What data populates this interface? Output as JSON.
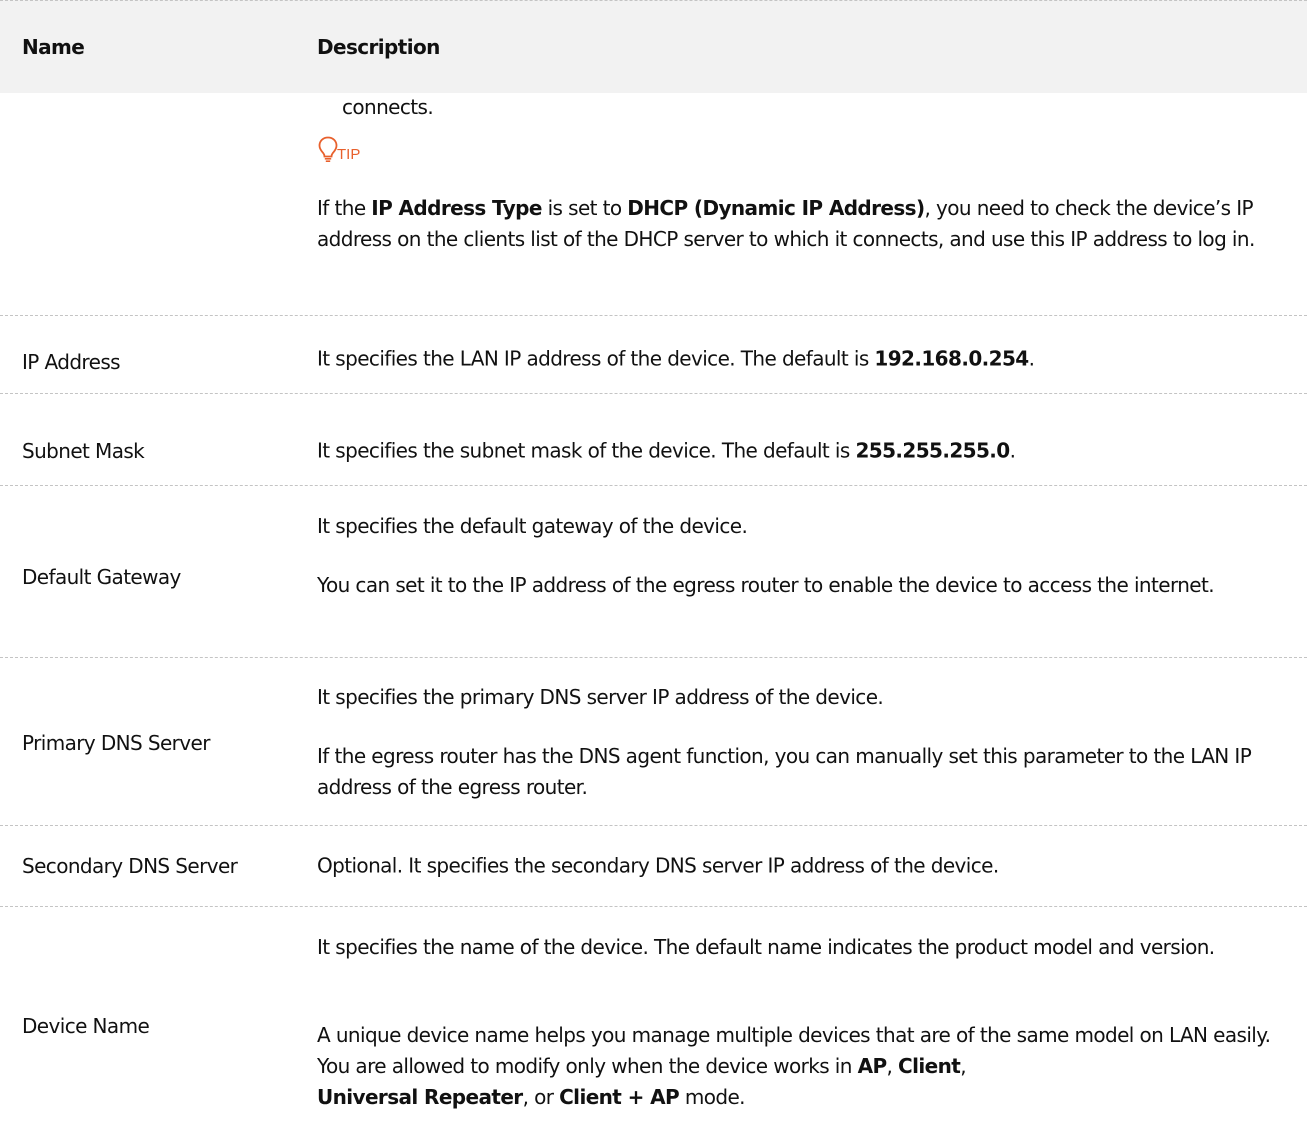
{
  "header": {
    "name": "Name",
    "description": "Description"
  },
  "continuation": {
    "text": "connects.",
    "tip_label": "TIP",
    "tip": {
      "t1": "If the ",
      "b1": "IP Address Type",
      "t2": " is set to ",
      "b2": "DHCP (Dynamic IP Address)",
      "t3": ", you need to check the device’s IP address on the clients list of the DHCP server to which it connects, and use this IP address to log in."
    }
  },
  "rows": {
    "ip_address": {
      "name": "IP Address",
      "t1": "It specifies the LAN IP address of the device. The default is ",
      "b1": "192.168.0.254",
      "t2": "."
    },
    "subnet_mask": {
      "name": "Subnet Mask",
      "t1": "It specifies the subnet mask of the device. The default is ",
      "b1": "255.255.255.0",
      "t2": "."
    },
    "default_gateway": {
      "name": "Default Gateway",
      "p1": "It specifies the default gateway of the device.",
      "p2": "You can set it to the IP address of the egress router to enable the device to access the internet."
    },
    "primary_dns": {
      "name": "Primary DNS Server",
      "p1": "It specifies the primary DNS server IP address of the device.",
      "p2": "If the egress router has the DNS agent function, you can manually set this parameter to the LAN IP address of the egress router."
    },
    "secondary_dns": {
      "name": "Secondary DNS Server",
      "p1": "Optional. It specifies the secondary DNS server IP address of the device."
    },
    "device_name": {
      "name": "Device Name",
      "p1": "It specifies the name of the device. The default name indicates the product model and version.",
      "p2_t1": "A unique device name helps you manage multiple devices that are of the same model on LAN easily. You are allowed to modify only when the device works in ",
      "p2_b1": "AP",
      "p2_t2": ", ",
      "p2_b2": "Client",
      "p2_t3": ", ",
      "p2_b3": "Universal Repeater",
      "p2_t4": ", or ",
      "p2_b4": "Client + AP",
      "p2_t5": " mode."
    }
  },
  "colors": {
    "header_bg": "#f2f2f2",
    "tip_accent": "#e8602c",
    "border": "#c4c4c4"
  }
}
